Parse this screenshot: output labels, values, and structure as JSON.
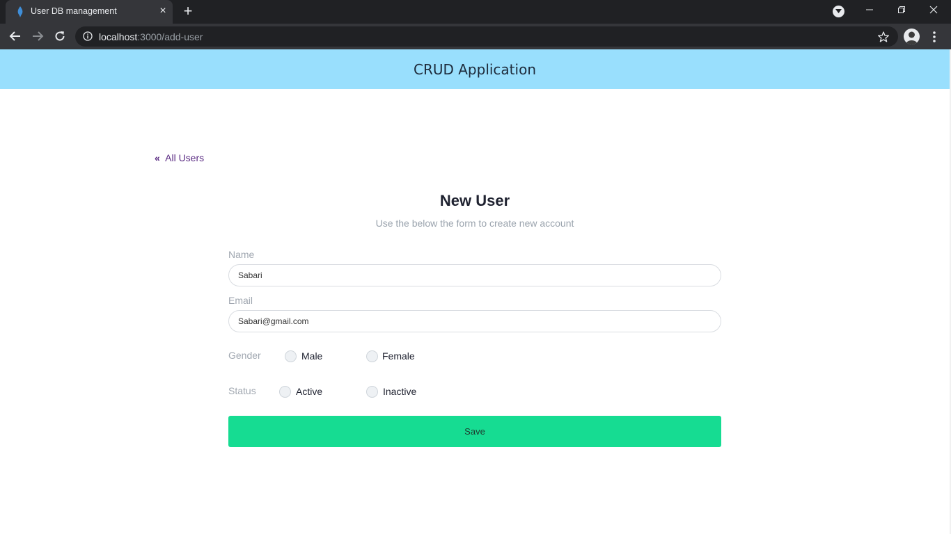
{
  "browser": {
    "tab_title": "User DB management",
    "url_host": "localhost",
    "url_path": ":3000/add-user",
    "new_tab_label": "+",
    "close_tab_label": "×"
  },
  "header": {
    "app_title": "CRUD Application",
    "background_color": "#99dffd"
  },
  "nav": {
    "back_link_label": "All Users"
  },
  "form": {
    "title": "New User",
    "subtitle": "Use the below the form to create new account",
    "name": {
      "label": "Name",
      "value": "Sabari"
    },
    "email": {
      "label": "Email",
      "value": "Sabari@gmail.com"
    },
    "gender": {
      "label": "Gender",
      "options": [
        "Male",
        "Female"
      ],
      "selected": null
    },
    "status": {
      "label": "Status",
      "options": [
        "Active",
        "Inactive"
      ],
      "selected": null
    },
    "save_label": "Save",
    "save_color": "#16dc92"
  }
}
